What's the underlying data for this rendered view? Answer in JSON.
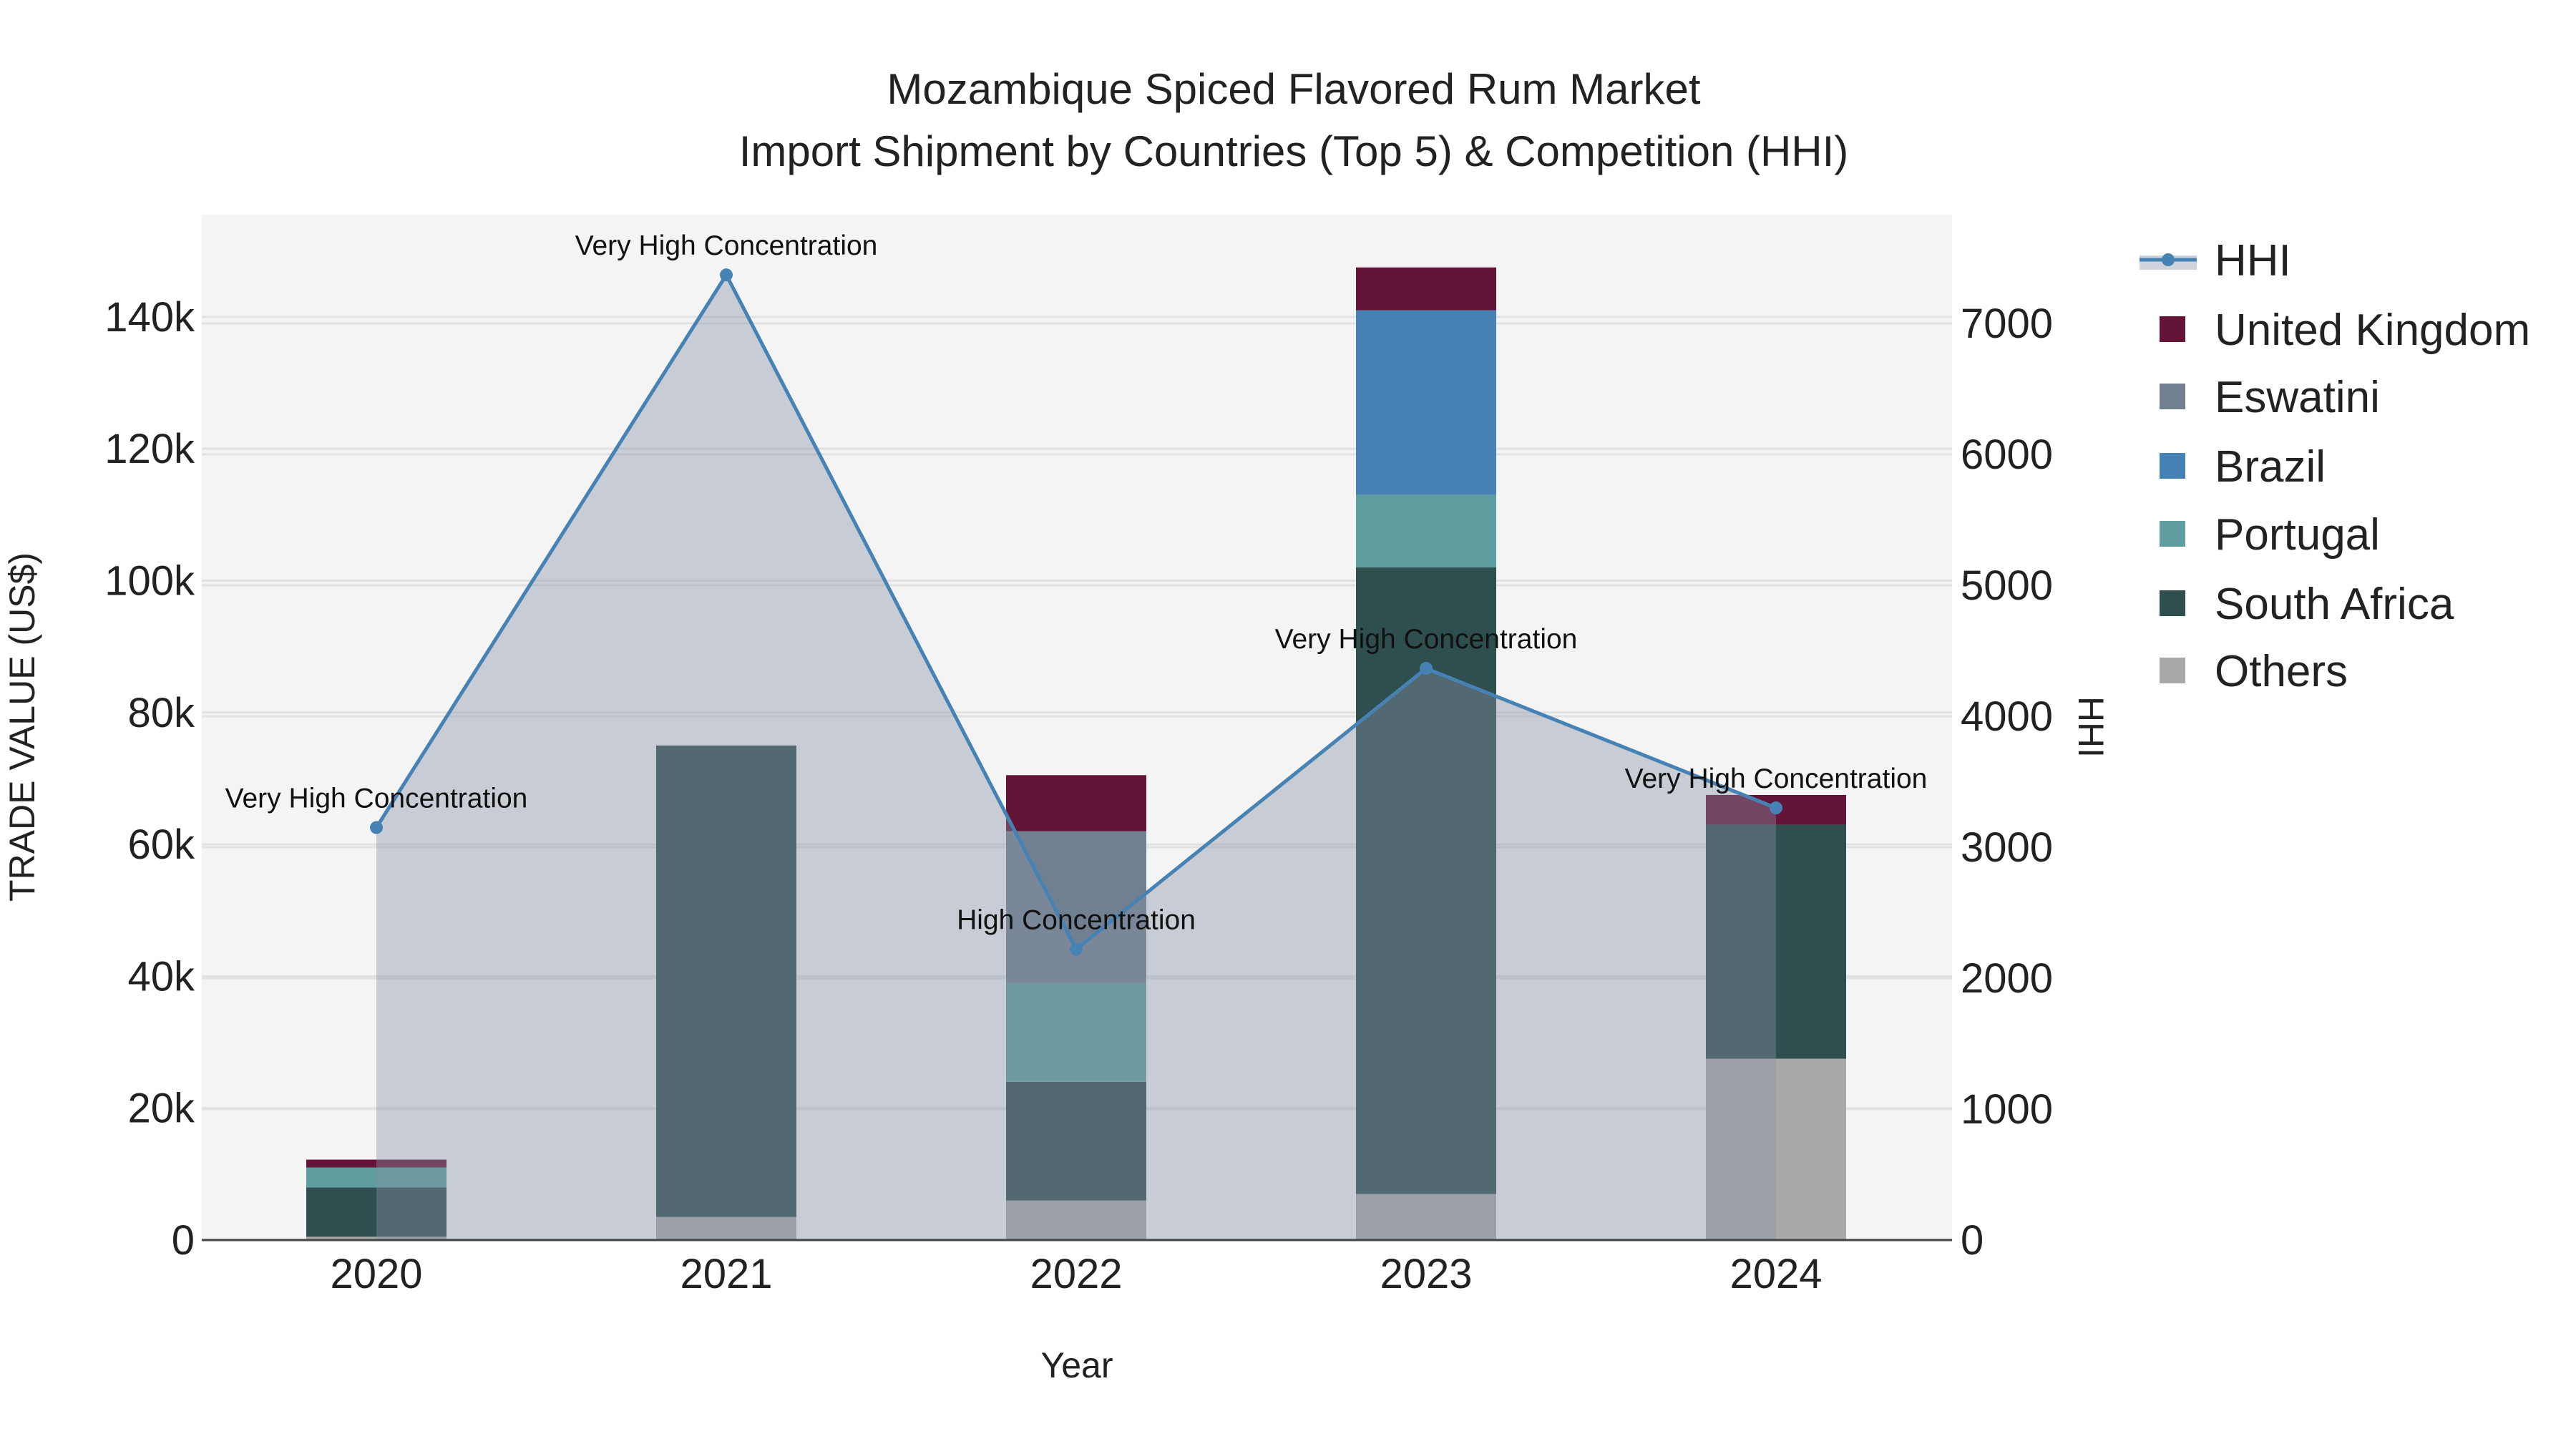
{
  "chart_data": {
    "type": "bar",
    "title_line1": "Mozambique Spiced Flavored Rum Market",
    "title_line2": "Import Shipment by Countries (Top 5) & Competition (HHI)",
    "xlabel": "Year",
    "ylabel": "TRADE VALUE (US$)",
    "y2label": "HHI",
    "categories": [
      "2020",
      "2021",
      "2022",
      "2023",
      "2024"
    ],
    "ylim": [
      0,
      155500
    ],
    "y2lim": [
      0,
      7830
    ],
    "yticks": [
      0,
      20000,
      40000,
      60000,
      80000,
      100000,
      120000,
      140000
    ],
    "ytick_labels": [
      "0",
      "20k",
      "40k",
      "60k",
      "80k",
      "100k",
      "120k",
      "140k"
    ],
    "y2ticks": [
      0,
      1000,
      2000,
      3000,
      4000,
      5000,
      6000,
      7000
    ],
    "y2tick_labels": [
      "0",
      "1000",
      "2000",
      "3000",
      "4000",
      "5000",
      "6000",
      "7000"
    ],
    "series": [
      {
        "name": "Others",
        "color": "#a9a9a9",
        "values": [
          500,
          3500,
          6000,
          7000,
          27500
        ]
      },
      {
        "name": "South Africa",
        "color": "#2f4f4f",
        "values": [
          7500,
          71500,
          18000,
          95000,
          35500
        ]
      },
      {
        "name": "Portugal",
        "color": "#5f9ea0",
        "values": [
          3000,
          0,
          15000,
          11000,
          0
        ]
      },
      {
        "name": "Brazil",
        "color": "#4682b4",
        "values": [
          0,
          0,
          0,
          28000,
          0
        ]
      },
      {
        "name": "Eswatini",
        "color": "#708090",
        "values": [
          0,
          0,
          23000,
          0,
          0
        ]
      },
      {
        "name": "United Kingdom",
        "color": "#641436",
        "values": [
          1200,
          0,
          8500,
          6500,
          4500
        ]
      }
    ],
    "hhi": {
      "name": "HHI",
      "color": "#4682b4",
      "values": [
        3150,
        7370,
        2220,
        4365,
        3300
      ],
      "annotations": [
        "Very High Concentration",
        "Very High Concentration",
        "High Concentration",
        "Very High Concentration",
        "Very High Concentration"
      ]
    },
    "legend": [
      "HHI",
      "United Kingdom",
      "Eswatini",
      "Brazil",
      "Portugal",
      "South Africa",
      "Others"
    ],
    "legend_position": "right",
    "grid": true
  }
}
